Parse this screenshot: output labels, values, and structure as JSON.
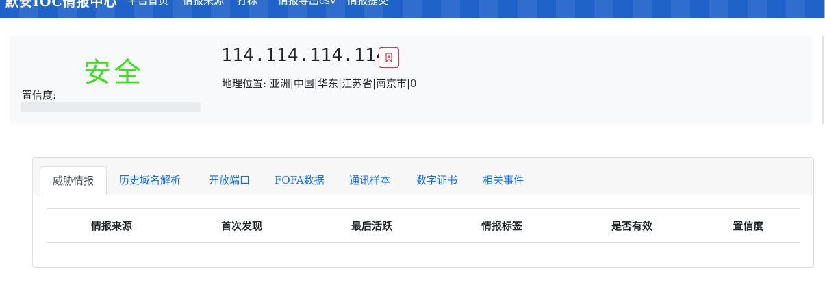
{
  "nav": {
    "brand": "默安IOC情报中心",
    "items": [
      "平台首页",
      "情报来源",
      "打标",
      "情报导出csv",
      "情报提交"
    ]
  },
  "summary": {
    "verdict": "安全",
    "verdict_color": "#3ee01c",
    "confidence_label": "置信度:",
    "confidence_value": 0,
    "ip": "114.114.114.114",
    "geo_label": "地理位置:",
    "geo_value": "亚洲|中国|华东|江苏省|南京市|0"
  },
  "tabs": [
    {
      "label": "威胁情报",
      "active": true
    },
    {
      "label": "历史域名解析",
      "active": false
    },
    {
      "label": "开放端口",
      "active": false
    },
    {
      "label": "FOFA数据",
      "active": false
    },
    {
      "label": "通讯样本",
      "active": false
    },
    {
      "label": "数字证书",
      "active": false
    },
    {
      "label": "相关事件",
      "active": false
    }
  ],
  "table": {
    "columns": [
      "情报来源",
      "首次发现",
      "最后活跃",
      "情报标签",
      "是否有效",
      "置信度"
    ]
  },
  "colors": {
    "nav_bg": "#1f63c9",
    "link": "#0d6efd",
    "bookmark_border": "#dc3545"
  }
}
